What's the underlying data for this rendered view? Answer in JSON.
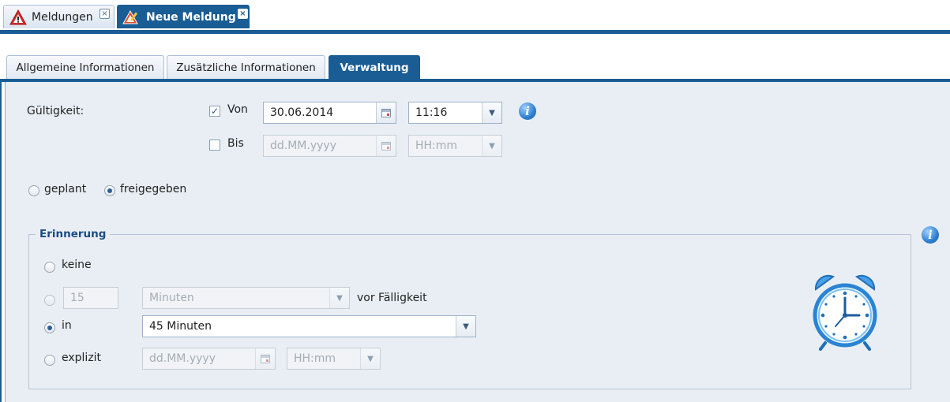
{
  "top_tabs": [
    {
      "label": "Meldungen",
      "icon": "warning-icon",
      "active": false
    },
    {
      "label": "Neue Meldung",
      "icon": "edit-warning-icon",
      "active": true
    }
  ],
  "inner_tabs": [
    {
      "label": "Allgemeine Informationen",
      "active": false
    },
    {
      "label": "Zusätzliche Informationen",
      "active": false
    },
    {
      "label": "Verwaltung",
      "active": true
    }
  ],
  "validity": {
    "label": "Gültigkeit:",
    "from": {
      "checked": true,
      "label": "Von",
      "date": "30.06.2014",
      "time": "11:16"
    },
    "to": {
      "checked": false,
      "label": "Bis",
      "date_placeholder": "dd.MM.yyyy",
      "time_placeholder": "HH:mm"
    }
  },
  "status": {
    "options": [
      "geplant",
      "freigegeben"
    ],
    "selected": "freigegeben"
  },
  "reminder": {
    "legend": "Erinnerung",
    "selected": "in",
    "none_label": "keine",
    "before": {
      "amount": "15",
      "unit": "Minuten",
      "suffix": "vor Fälligkeit"
    },
    "in": {
      "label": "in",
      "value": "45 Minuten"
    },
    "explicit": {
      "label": "explizit",
      "date_placeholder": "dd.MM.yyyy",
      "time_placeholder": "HH:mm"
    }
  },
  "colors": {
    "accent": "#1a5d95",
    "panel": "#e9eef5"
  }
}
